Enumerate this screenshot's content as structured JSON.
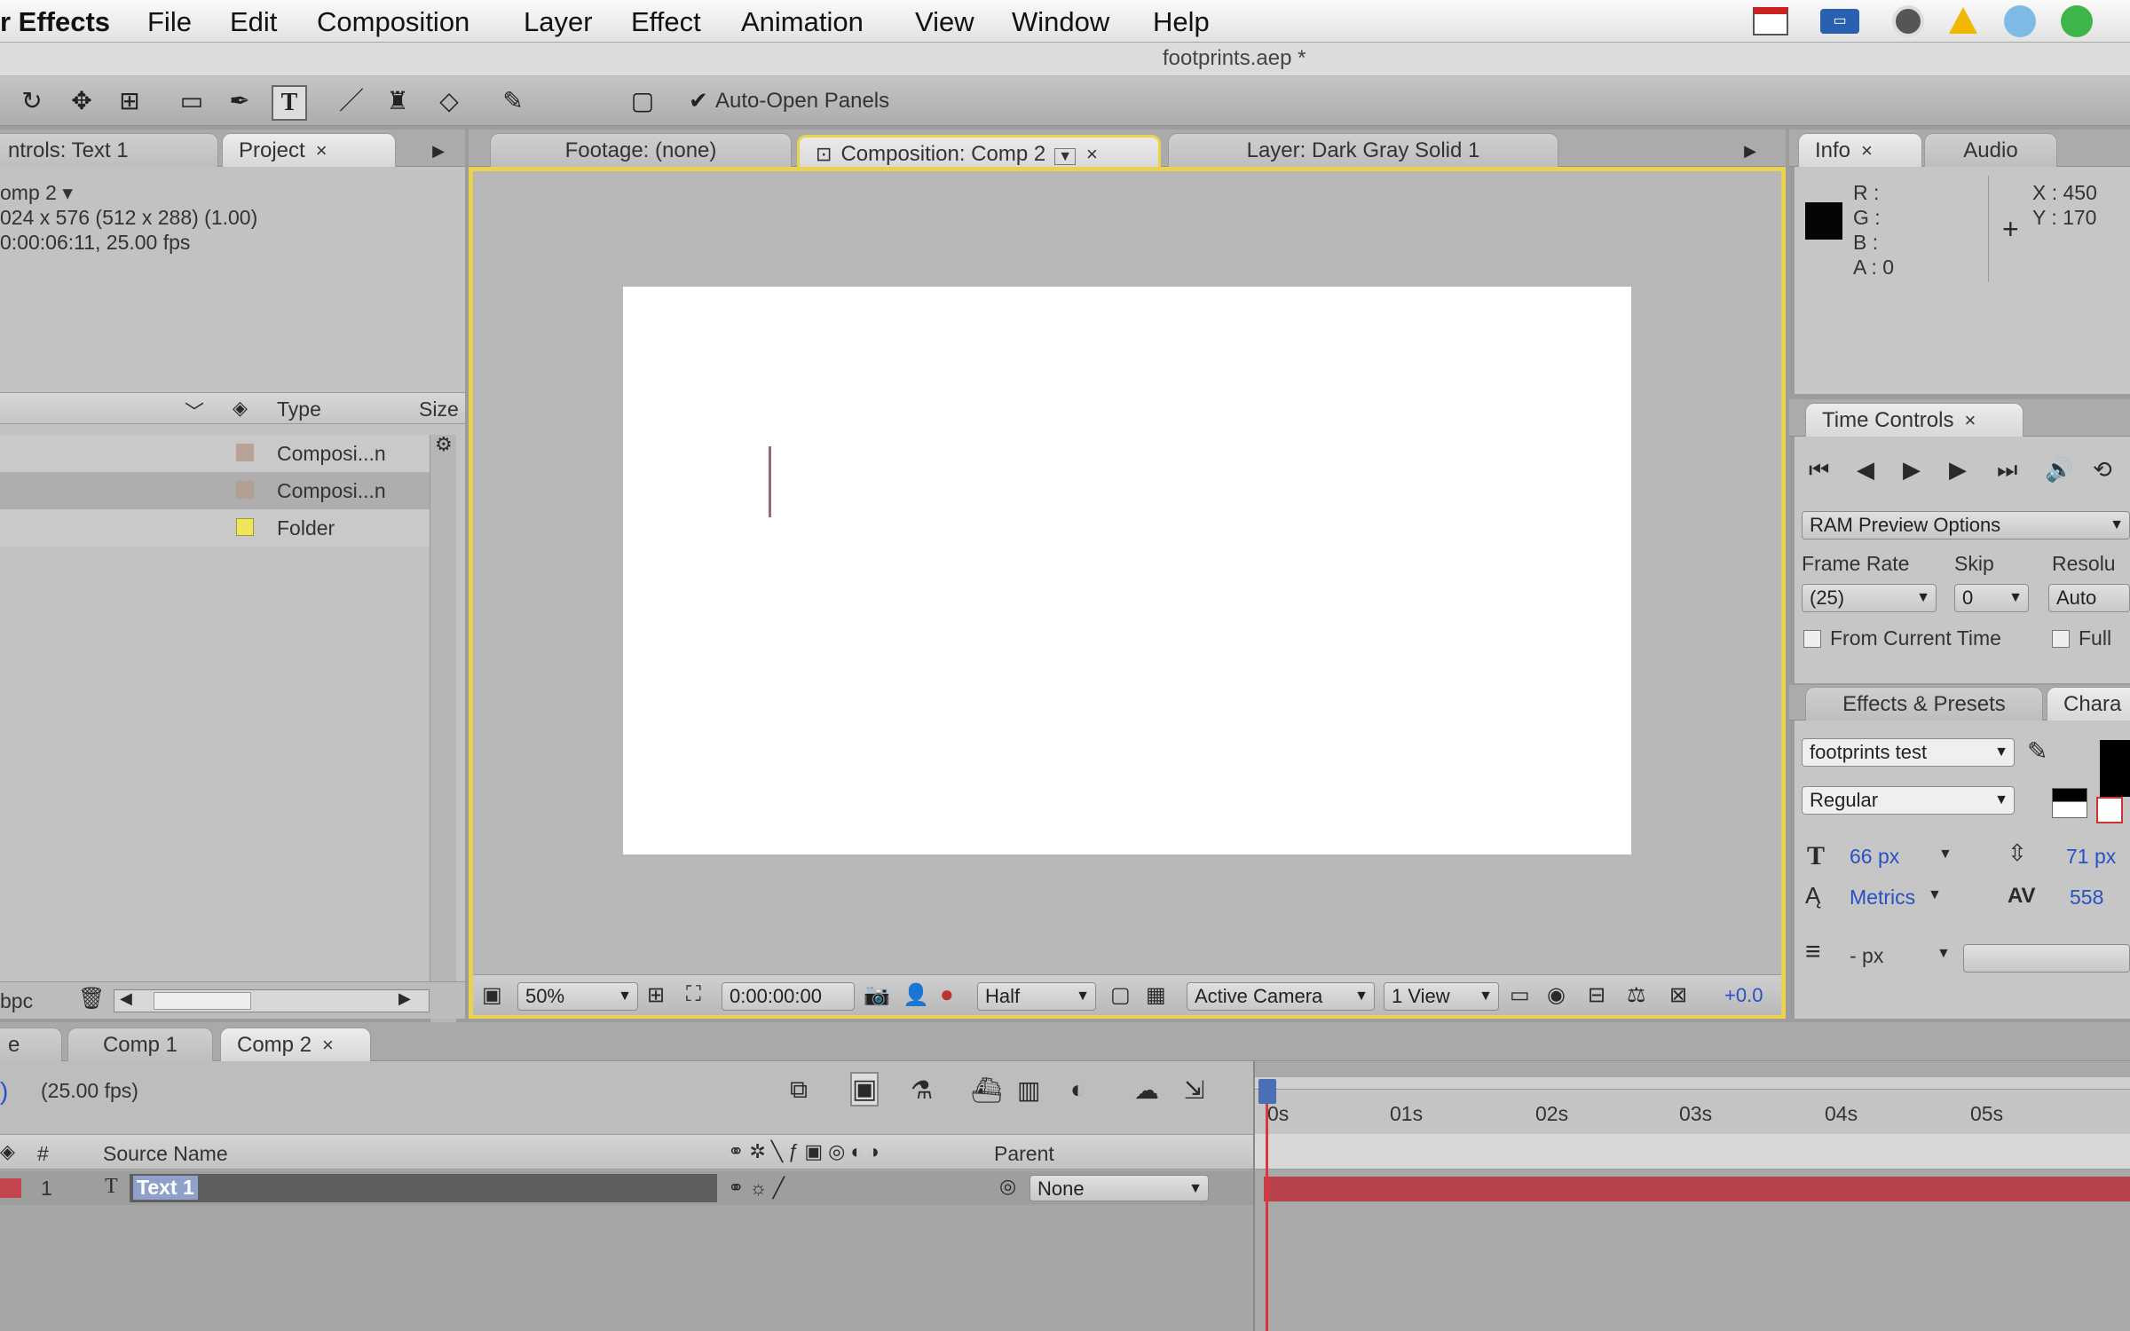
{
  "menubar": {
    "app": "r Effects",
    "items": [
      "File",
      "Edit",
      "Composition",
      "Layer",
      "Effect",
      "Animation",
      "View",
      "Window",
      "Help"
    ]
  },
  "document_title": "footprints.aep *",
  "toolbar": {
    "auto_open_panels": "Auto-Open Panels"
  },
  "left_panel": {
    "tabs": {
      "controls": "ntrols: Text 1",
      "project": "Project"
    },
    "comp_name": "omp 2 ▾",
    "comp_dims": "024 x 576  (512 x 288) (1.00)",
    "comp_duration": "0:00:06:11, 25.00 fps",
    "columns": {
      "type": "Type",
      "size": "Size"
    },
    "rows": [
      {
        "type": "Composi...n",
        "color": "#b9a398"
      },
      {
        "type": "Composi...n",
        "color": "#b9a398"
      },
      {
        "type": "Folder",
        "color": "#efe55a"
      }
    ],
    "footer_bpc": "bpc"
  },
  "viewer": {
    "tabs": {
      "footage": "Footage: (none)",
      "composition": "Composition: Comp 2",
      "layer": "Layer: Dark Gray Solid 1"
    },
    "bottom": {
      "zoom": "50%",
      "timecode": "0:00:00:00",
      "resolution": "Half",
      "camera": "Active Camera",
      "views": "1 View",
      "exposure": "+0.0"
    }
  },
  "info_panel": {
    "tabs": {
      "info": "Info",
      "audio": "Audio"
    },
    "r": "R :",
    "g": "G :",
    "b": "B :",
    "a": "A :  0",
    "x": "X : 450",
    "y": "Y : 170"
  },
  "time_controls": {
    "title": "Time Controls",
    "ram_preview": "RAM Preview Options",
    "frame_rate_label": "Frame Rate",
    "skip_label": "Skip",
    "resolution_label": "Resolu",
    "frame_rate": "(25)",
    "skip": "0",
    "resolution": "Auto",
    "from_current": "From Current Time",
    "full": "Full"
  },
  "effects_char": {
    "tabs": {
      "effects": "Effects & Presets",
      "char": "Chara"
    },
    "font": "footprints test",
    "style": "Regular",
    "size": "66 px",
    "leading": "71 px",
    "kerning": "Metrics",
    "tracking": "558",
    "stroke_unit": "- px"
  },
  "timeline": {
    "tabs": {
      "render": "e",
      "comp1": "Comp 1",
      "comp2": "Comp 2"
    },
    "fps": "(25.00 fps)",
    "columns": {
      "num": "#",
      "source": "Source Name",
      "parent": "Parent"
    },
    "layer": {
      "num": "1",
      "name": "Text 1",
      "parent": "None"
    },
    "ruler": [
      "0s",
      "01s",
      "02s",
      "03s",
      "04s",
      "05s"
    ]
  }
}
